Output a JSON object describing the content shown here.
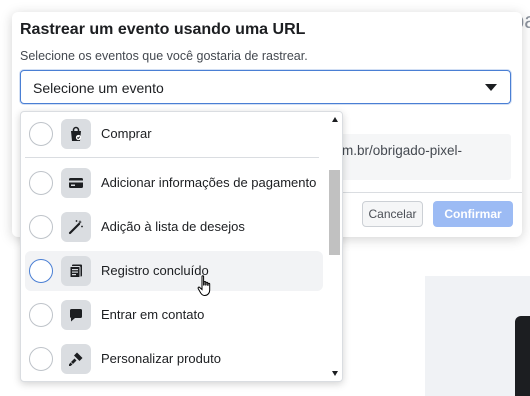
{
  "modal": {
    "title": "Rastrear um evento usando uma URL",
    "subtitle": "Selecione os eventos que você gostaria de rastrear.",
    "select_value": "Selecione um evento",
    "url_text": "m.br/obrigado-pixel-",
    "cancel_label": "Cancelar",
    "confirm_label": "Confirmar"
  },
  "dropdown": {
    "options": [
      {
        "label": "Comprar",
        "icon": "shopping-bag-icon"
      },
      {
        "label": "Adicionar informações de pagamento",
        "icon": "credit-card-icon"
      },
      {
        "label": "Adição à lista de desejos",
        "icon": "magic-wand-icon"
      },
      {
        "label": "Registro concluído",
        "icon": "register-pages-icon",
        "hovered": true
      },
      {
        "label": "Entrar em contato",
        "icon": "chat-bubble-icon"
      },
      {
        "label": "Personalizar produto",
        "icon": "paintbrush-icon"
      }
    ]
  },
  "background": {
    "right_text": "pa"
  },
  "colors": {
    "accent": "#4a7fd4",
    "confirm_disabled": "#9cbbf4",
    "icon_tile": "#dadde1",
    "hover_row": "#f2f3f5"
  }
}
